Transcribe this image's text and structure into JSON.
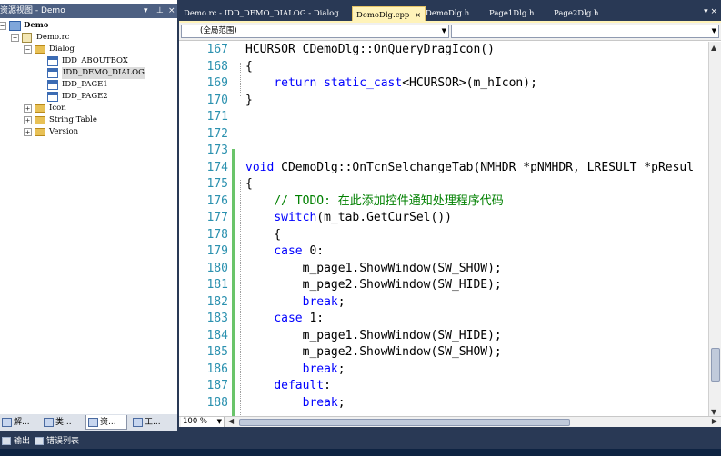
{
  "resource_view": {
    "title": "资源视图 - Demo",
    "controls": [
      "▾",
      "⊥",
      "×"
    ],
    "tree": [
      {
        "label": "Demo",
        "level": 0,
        "icon": "project-icon",
        "expander": "-",
        "bold": true
      },
      {
        "label": "Demo.rc",
        "level": 1,
        "icon": "rc-file-icon",
        "expander": "-"
      },
      {
        "label": "Dialog",
        "level": 2,
        "icon": "folder-icon",
        "expander": "-"
      },
      {
        "label": "IDD_ABOUTBOX",
        "level": 3,
        "icon": "dialog-icon"
      },
      {
        "label": "IDD_DEMO_DIALOG",
        "level": 3,
        "icon": "dialog-icon",
        "selected": true
      },
      {
        "label": "IDD_PAGE1",
        "level": 3,
        "icon": "dialog-icon"
      },
      {
        "label": "IDD_PAGE2",
        "level": 3,
        "icon": "dialog-icon"
      },
      {
        "label": "Icon",
        "level": 2,
        "icon": "folder-icon",
        "expander": "+"
      },
      {
        "label": "String Table",
        "level": 2,
        "icon": "folder-icon",
        "expander": "+"
      },
      {
        "label": "Version",
        "level": 2,
        "icon": "folder-icon",
        "expander": "+"
      }
    ],
    "bottom_tabs": [
      {
        "label": "解...",
        "icon": "solution-explorer-icon"
      },
      {
        "label": "类...",
        "icon": "class-view-icon"
      },
      {
        "label": "资...",
        "icon": "resource-view-icon",
        "active": true
      },
      {
        "label": "工...",
        "icon": "toolbox-icon"
      }
    ]
  },
  "editor_tabs": [
    {
      "label": "Demo.rc - IDD_DEMO_DIALOG - Dialog"
    },
    {
      "label": "DemoDlg.cpp",
      "active": true,
      "close": "×"
    },
    {
      "label": "DemoDlg.h"
    },
    {
      "label": "Page1Dlg.h"
    },
    {
      "label": "Page2Dlg.h"
    }
  ],
  "tab_controls": "▾ ×",
  "nav": {
    "scope": "(全局范围)",
    "member": ""
  },
  "code": {
    "lines": [
      {
        "n": "167",
        "text": "HCURSOR CDemoDlg::OnQueryDragIcon()",
        "collapse": "-"
      },
      {
        "n": "168",
        "text": "{"
      },
      {
        "n": "169",
        "text": "    return static_cast<HCURSOR>(m_hIcon);"
      },
      {
        "n": "170",
        "text": "}"
      },
      {
        "n": "171",
        "text": ""
      },
      {
        "n": "172",
        "text": ""
      },
      {
        "n": "173",
        "text": ""
      },
      {
        "n": "174",
        "text": "void CDemoDlg::OnTcnSelchangeTab(NMHDR *pNMHDR, LRESULT *pResul",
        "collapse": "-"
      },
      {
        "n": "175",
        "text": "{"
      },
      {
        "n": "176",
        "text": "    // TODO: 在此添加控件通知处理程序代码"
      },
      {
        "n": "177",
        "text": "    switch(m_tab.GetCurSel())"
      },
      {
        "n": "178",
        "text": "    {"
      },
      {
        "n": "179",
        "text": "    case 0:"
      },
      {
        "n": "180",
        "text": "        m_page1.ShowWindow(SW_SHOW);"
      },
      {
        "n": "181",
        "text": "        m_page2.ShowWindow(SW_HIDE);"
      },
      {
        "n": "182",
        "text": "        break;"
      },
      {
        "n": "183",
        "text": "    case 1:"
      },
      {
        "n": "184",
        "text": "        m_page1.ShowWindow(SW_HIDE);"
      },
      {
        "n": "185",
        "text": "        m_page2.ShowWindow(SW_SHOW);"
      },
      {
        "n": "186",
        "text": "        break;"
      },
      {
        "n": "187",
        "text": "    default:"
      },
      {
        "n": "188",
        "text": "        break;"
      }
    ]
  },
  "zoom": "100 %",
  "output_tabs": [
    {
      "label": "输出",
      "icon": "output-icon"
    },
    {
      "label": "错误列表",
      "icon": "error-list-icon"
    }
  ],
  "colors": {
    "chrome": "#293955",
    "active_tab": "#fff3b9",
    "keyword": "#0000ff",
    "comment": "#008000",
    "line_number": "#2b91af",
    "change_bar": "#6ac46a"
  }
}
